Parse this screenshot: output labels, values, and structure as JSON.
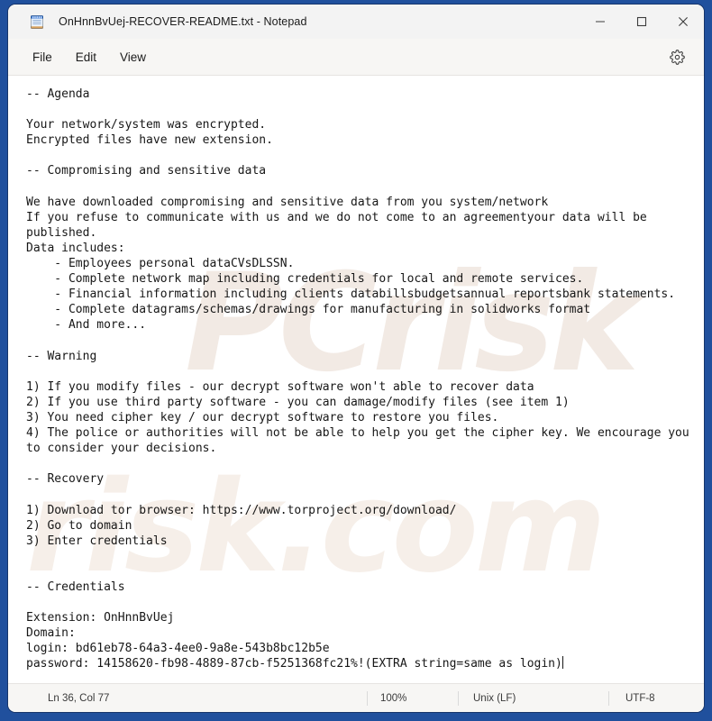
{
  "window": {
    "title": "OnHnnBvUej-RECOVER-README.txt - Notepad",
    "app_icon": "notepad-icon",
    "frame_color": "#20509d",
    "controls": {
      "minimize": "minimize-icon",
      "maximize": "maximize-icon",
      "close": "close-icon"
    }
  },
  "menubar": {
    "items": [
      {
        "label": "File"
      },
      {
        "label": "Edit"
      },
      {
        "label": "View"
      }
    ],
    "settings_icon": "gear-icon"
  },
  "watermark": {
    "top": "PCrisk",
    "bottom": "risk.com"
  },
  "document": {
    "lines": [
      "-- Agenda",
      "",
      "Your network/system was encrypted.",
      "Encrypted files have new extension.",
      "",
      "-- Compromising and sensitive data",
      "",
      "We have downloaded compromising and sensitive data from you system/network",
      "If you refuse to communicate with us and we do not come to an agreementyour data will be",
      "published.",
      "Data includes:",
      "    - Employees personal dataCVsDLSSN.",
      "    - Complete network map including credentials for local and remote services.",
      "    - Financial information including clients databillsbudgetsannual reportsbank statements.",
      "    - Complete datagrams/schemas/drawings for manufacturing in solidworks format",
      "    - And more...",
      "",
      "-- Warning",
      "",
      "1) If you modify files - our decrypt software won't able to recover data",
      "2) If you use third party software - you can damage/modify files (see item 1)",
      "3) You need cipher key / our decrypt software to restore you files.",
      "4) The police or authorities will not be able to help you get the cipher key. We encourage you",
      "to consider your decisions.",
      "",
      "-- Recovery",
      "",
      "1) Download tor browser: https://www.torproject.org/download/",
      "2) Go to domain",
      "3) Enter credentials",
      "",
      "",
      "-- Credentials",
      "",
      "Extension: OnHnnBvUej",
      "Domain:",
      "login: bd61eb78-64a3-4ee0-9a8e-543b8bc12b5e",
      "password: 14158620-fb98-4889-87cb-f5251368fc21%!(EXTRA string=same as login)"
    ]
  },
  "statusbar": {
    "position": "Ln 36, Col 77",
    "zoom": "100%",
    "line_ending": "Unix (LF)",
    "encoding": "UTF-8"
  }
}
